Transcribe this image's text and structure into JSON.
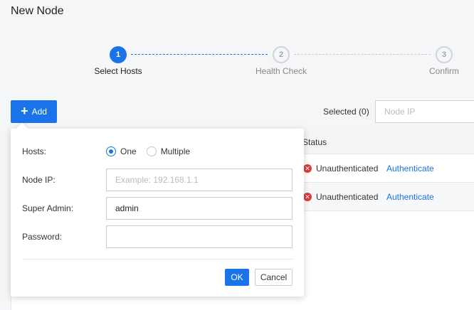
{
  "page": {
    "title": "New Node"
  },
  "steps": [
    {
      "number": "1",
      "label": "Select Hosts",
      "state": "active"
    },
    {
      "number": "2",
      "label": "Health Check",
      "state": "idle"
    },
    {
      "number": "3",
      "label": "Confirm",
      "state": "idle"
    }
  ],
  "toolbar": {
    "add_label": "Add",
    "add_icon": "plus-icon",
    "selected_text": "Selected (0)",
    "search_placeholder": "Node IP",
    "accent_color": "#1a73e8"
  },
  "table": {
    "columns": [
      "Status"
    ],
    "rows": [
      {
        "status_icon": "error-icon",
        "status": "Unauthenticated",
        "action": "Authenticate"
      },
      {
        "status_icon": "error-icon",
        "status": "Unauthenticated",
        "action": "Authenticate"
      }
    ]
  },
  "add_form": {
    "hosts_label": "Hosts:",
    "hosts_options": [
      "One",
      "Multiple"
    ],
    "hosts_selected": "One",
    "node_ip_label": "Node IP:",
    "node_ip_placeholder": "Example: 192.168.1.1",
    "node_ip_value": "",
    "super_admin_label": "Super Admin:",
    "super_admin_value": "admin",
    "password_label": "Password:",
    "password_value": "",
    "ok_label": "OK",
    "cancel_label": "Cancel"
  }
}
